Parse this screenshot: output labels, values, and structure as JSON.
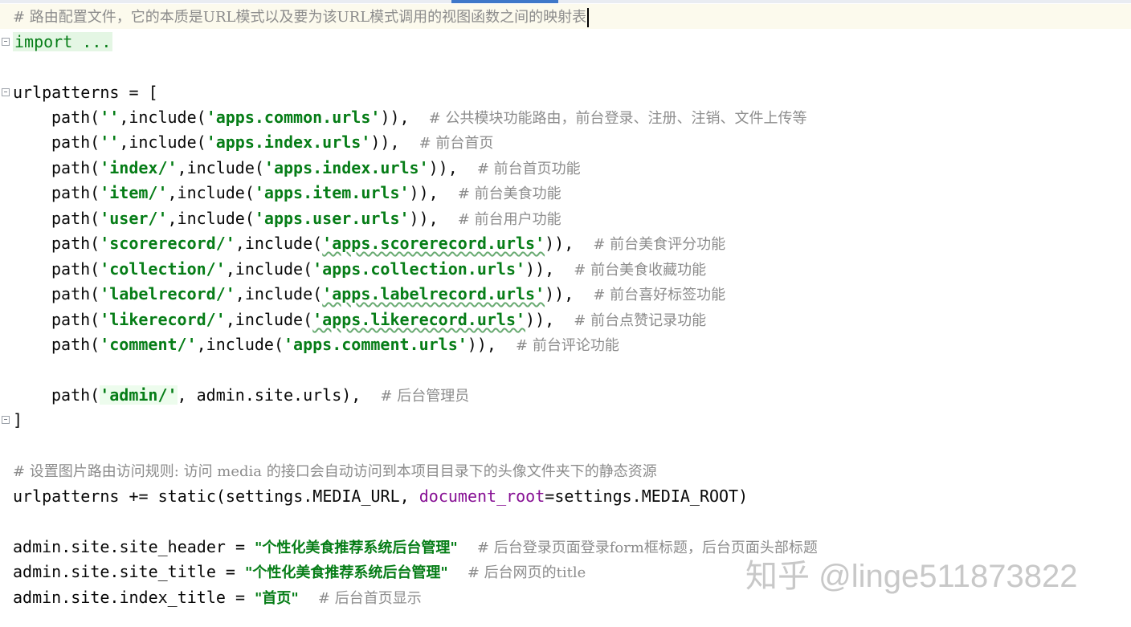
{
  "editor": {
    "line1_comment": "# 路由配置文件，它的本质是URL模式以及要为该URL模式调用的视图函数之间的映射表",
    "folded_import": "import ...",
    "urlpatterns_open": "urlpatterns = [",
    "routes": [
      {
        "prefix": "''",
        "module": "'apps.common.urls'",
        "comment": "# 公共模块功能路由，前台登录、注册、注销、文件上传等"
      },
      {
        "prefix": "''",
        "module": "'apps.index.urls'",
        "comment": "# 前台首页"
      },
      {
        "prefix": "'index/'",
        "module": "'apps.index.urls'",
        "comment": "# 前台首页功能"
      },
      {
        "prefix": "'item/'",
        "module": "'apps.item.urls'",
        "comment": "# 前台美食功能"
      },
      {
        "prefix": "'user/'",
        "module": "'apps.user.urls'",
        "comment": "# 前台用户功能"
      },
      {
        "prefix": "'scorerecord/'",
        "module": "'apps.scorerecord.urls'",
        "comment": "# 前台美食评分功能"
      },
      {
        "prefix": "'collection/'",
        "module": "'apps.collection.urls'",
        "comment": "# 前台美食收藏功能"
      },
      {
        "prefix": "'labelrecord/'",
        "module": "'apps.labelrecord.urls'",
        "comment": "# 前台喜好标签功能"
      },
      {
        "prefix": "'likerecord/'",
        "module": "'apps.likerecord.urls'",
        "comment": "# 前台点赞记录功能"
      },
      {
        "prefix": "'comment/'",
        "module": "'apps.comment.urls'",
        "comment": "# 前台评论功能"
      }
    ],
    "admin_route": {
      "prefix": "'admin/'",
      "target": " admin.site.urls",
      "comment": "# 后台管理员"
    },
    "urlpatterns_close": "]",
    "static_comment": "# 设置图片路由访问规则: 访问 media 的接口会自动访问到本项目目录下的头像文件夹下的静态资源",
    "static_line": {
      "start": "urlpatterns += static(settings.MEDIA_URL, ",
      "param": "document_root",
      "end": "=settings.MEDIA_ROOT)"
    },
    "site_header": {
      "code": "admin.site.site_header = ",
      "value": "\"个性化美食推荐系统后台管理\"",
      "comment": "# 后台登录页面登录form框标题，后台页面头部标题"
    },
    "site_title": {
      "code": "admin.site.site_title = ",
      "value": "\"个性化美食推荐系统后台管理\"",
      "comment": "# 后台网页的title"
    },
    "index_title": {
      "code": "admin.site.index_title = ",
      "value": "\"首页\"",
      "comment": "# 后台首页显示"
    }
  },
  "watermark": "知乎 @linge511873822",
  "colors": {
    "string": "#067d17",
    "comment": "#8c8c8c",
    "param": "#871094",
    "current_line": "#fcfaed"
  }
}
